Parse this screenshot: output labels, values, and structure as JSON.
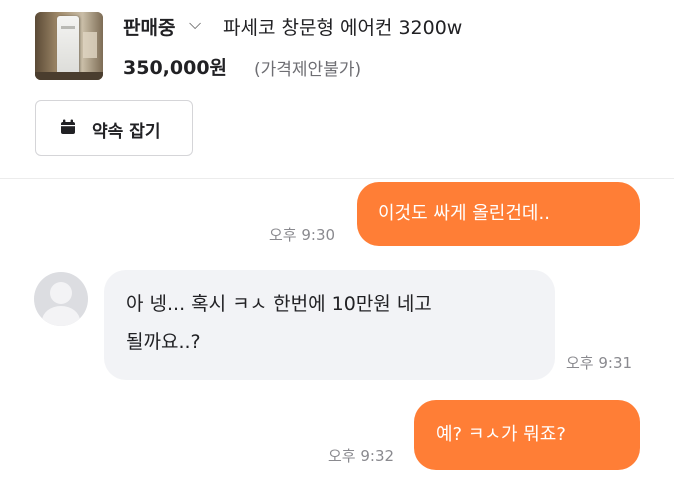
{
  "listing": {
    "status": "판매중",
    "status_chevron": "chevron-down-icon",
    "title": "파세코 창문형 에어컨 3200w",
    "price": "350,000원",
    "price_note": "(가격제안불가)"
  },
  "actions": {
    "appointment_label": "약속 잡기",
    "appointment_icon": "calendar-icon"
  },
  "messages": [
    {
      "from": "me",
      "text": "이것도 싸게 올린건데..",
      "time": "오후 9:30"
    },
    {
      "from": "other",
      "text_line1": "아 넹... 혹시 ㅋㅅ 한번에 10만원 네고",
      "text_line2": "될까요..?",
      "time": "오후 9:31"
    },
    {
      "from": "me",
      "text": "예? ㅋㅅ가 뭐죠?",
      "time": "오후 9:32"
    }
  ],
  "colors": {
    "outgoing_bubble": "#ff7e36",
    "incoming_bubble": "#f2f3f6",
    "primary_text": "#212124",
    "muted_text": "#8a8a8f"
  }
}
